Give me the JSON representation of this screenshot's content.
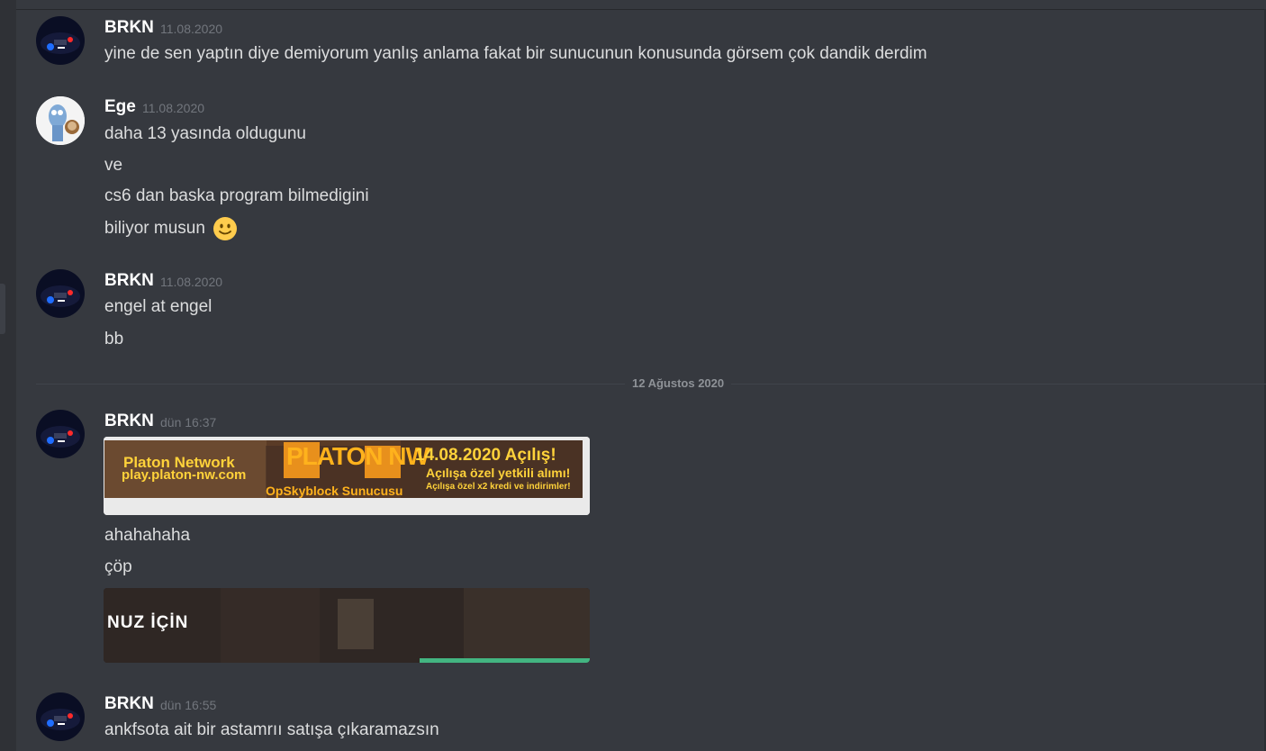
{
  "messages": [
    {
      "author": "BRKN",
      "timestamp": "11.08.2020",
      "lines": [
        "yine de sen yaptın diye demiyorum yanlış anlama fakat bir sunucunun konusunda görsem çok dandik derdim"
      ]
    },
    {
      "author": "Ege",
      "timestamp": "11.08.2020",
      "lines": [
        "daha 13 yasında oldugunu",
        "ve",
        "cs6 dan baska program bilmedigini",
        "biliyor musun"
      ],
      "emoji": "slight-smile-emoji"
    },
    {
      "author": "BRKN",
      "timestamp": "11.08.2020",
      "lines": [
        "engel at engel",
        "bb"
      ]
    },
    {
      "author": "BRKN",
      "timestamp": "dün 16:37",
      "banner": {
        "left_title": "Platon Network",
        "left_url": "play.platon-nw.com",
        "logo": "PLATON NW",
        "subtitle": "OpSkyblock Sunucusu",
        "date": "14.08.2020 Açılış!",
        "line1": "Açılışa özel yetkili alımı!",
        "line2": "Açılışa özel x2 kredi ve indirimler!"
      },
      "lines": [
        "ahahahaha",
        "çöp"
      ],
      "embed_text": "NUZ İÇİN"
    },
    {
      "author": "BRKN",
      "timestamp": "dün 16:55",
      "lines": [
        "ankfsota ait bir astamrıı satışa çıkaramazsın"
      ]
    }
  ],
  "date_divider": "12 Ağustos 2020",
  "colors": {
    "background": "#36393f",
    "username": "#ffffff",
    "text": "#dcddde",
    "timestamp": "#72767d",
    "embed_bar": "#43b581"
  }
}
